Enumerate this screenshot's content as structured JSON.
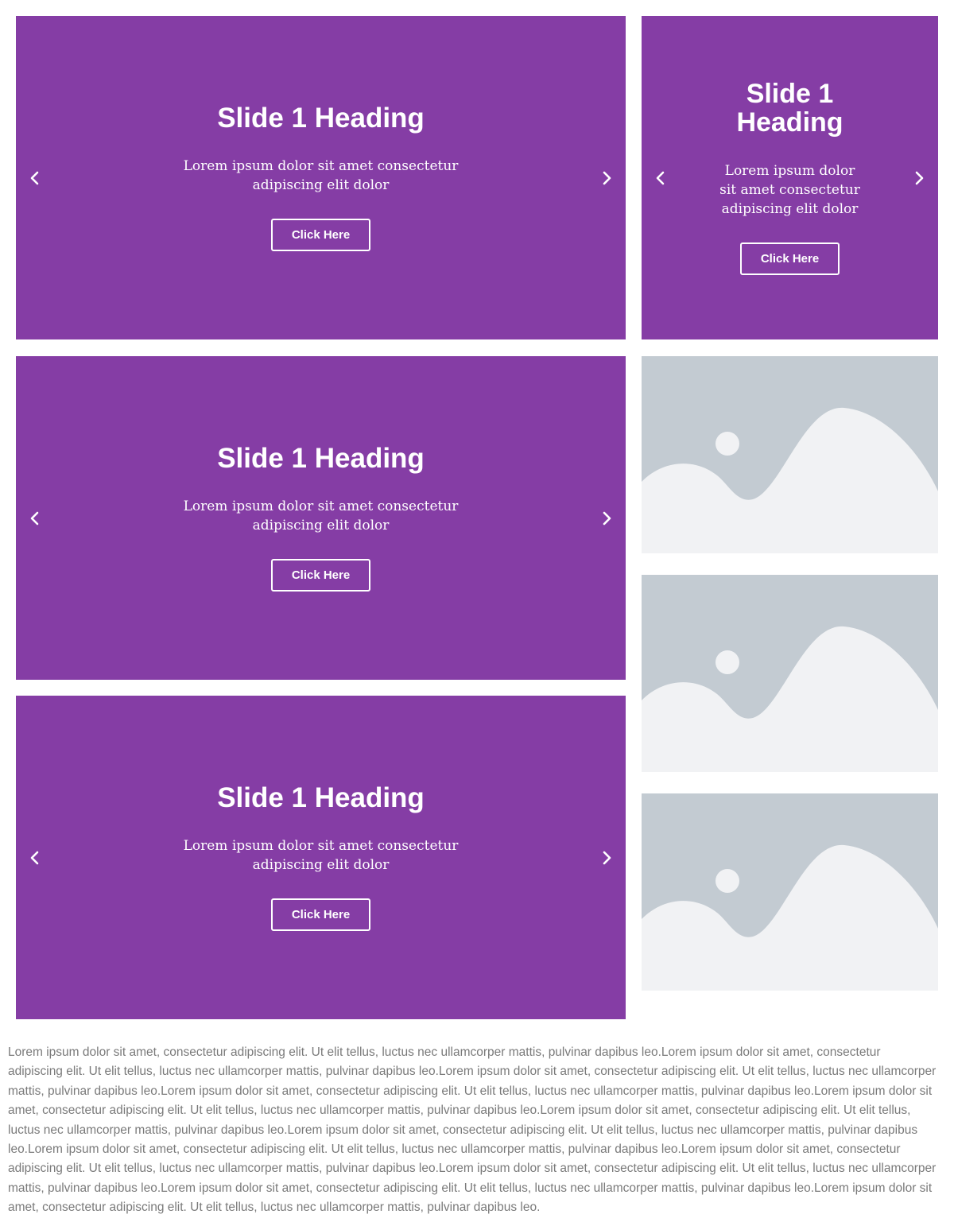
{
  "slides": [
    {
      "heading": "Slide 1 Heading",
      "text": "Lorem ipsum dolor sit amet consectetur adipiscing elit dolor",
      "button": "Click Here"
    },
    {
      "heading": "Slide 1 Heading",
      "text": "Lorem ipsum dolor sit amet consectetur adipiscing elit dolor",
      "button": "Click Here"
    },
    {
      "heading": "Slide 1 Heading",
      "text": "Lorem ipsum dolor sit amet consectetur adipiscing elit dolor",
      "button": "Click Here"
    },
    {
      "heading": "Slide 1 Heading",
      "text": "Lorem ipsum dolor sit amet consectetur adipiscing elit dolor",
      "button": "Click Here"
    }
  ],
  "icons": {
    "prev": "chevron-left-icon",
    "next": "chevron-right-icon",
    "placeholder": "image-placeholder-icon"
  },
  "colors": {
    "slide_bg": "#853da5",
    "placeholder_bg": "#c3cbd2",
    "placeholder_fg": "#f1f2f4",
    "body_text": "#7a7a7a"
  },
  "body_text": "Lorem ipsum dolor sit amet, consectetur adipiscing elit. Ut elit tellus, luctus nec ullamcorper mattis, pulvinar dapibus leo.Lorem ipsum dolor sit amet, consectetur adipiscing elit. Ut elit tellus, luctus nec ullamcorper mattis, pulvinar dapibus leo.Lorem ipsum dolor sit amet, consectetur adipiscing elit. Ut elit tellus, luctus nec ullamcorper mattis, pulvinar dapibus leo.Lorem ipsum dolor sit amet, consectetur adipiscing elit. Ut elit tellus, luctus nec ullamcorper mattis, pulvinar dapibus leo.Lorem ipsum dolor sit amet, consectetur adipiscing elit. Ut elit tellus, luctus nec ullamcorper mattis, pulvinar dapibus leo.Lorem ipsum dolor sit amet, consectetur adipiscing elit. Ut elit tellus, luctus nec ullamcorper mattis, pulvinar dapibus leo.Lorem ipsum dolor sit amet, consectetur adipiscing elit. Ut elit tellus, luctus nec ullamcorper mattis, pulvinar dapibus leo.Lorem ipsum dolor sit amet, consectetur adipiscing elit. Ut elit tellus, luctus nec ullamcorper mattis, pulvinar dapibus leo.Lorem ipsum dolor sit amet, consectetur adipiscing elit. Ut elit tellus, luctus nec ullamcorper mattis, pulvinar dapibus leo.Lorem ipsum dolor sit amet, consectetur adipiscing elit. Ut elit tellus, luctus nec ullamcorper mattis, pulvinar dapibus leo.Lorem ipsum dolor sit amet, consectetur adipiscing elit. Ut elit tellus, luctus nec ullamcorper mattis, pulvinar dapibus leo.Lorem ipsum dolor sit amet, consectetur adipiscing elit. Ut elit tellus, luctus nec ullamcorper mattis, pulvinar dapibus leo."
}
